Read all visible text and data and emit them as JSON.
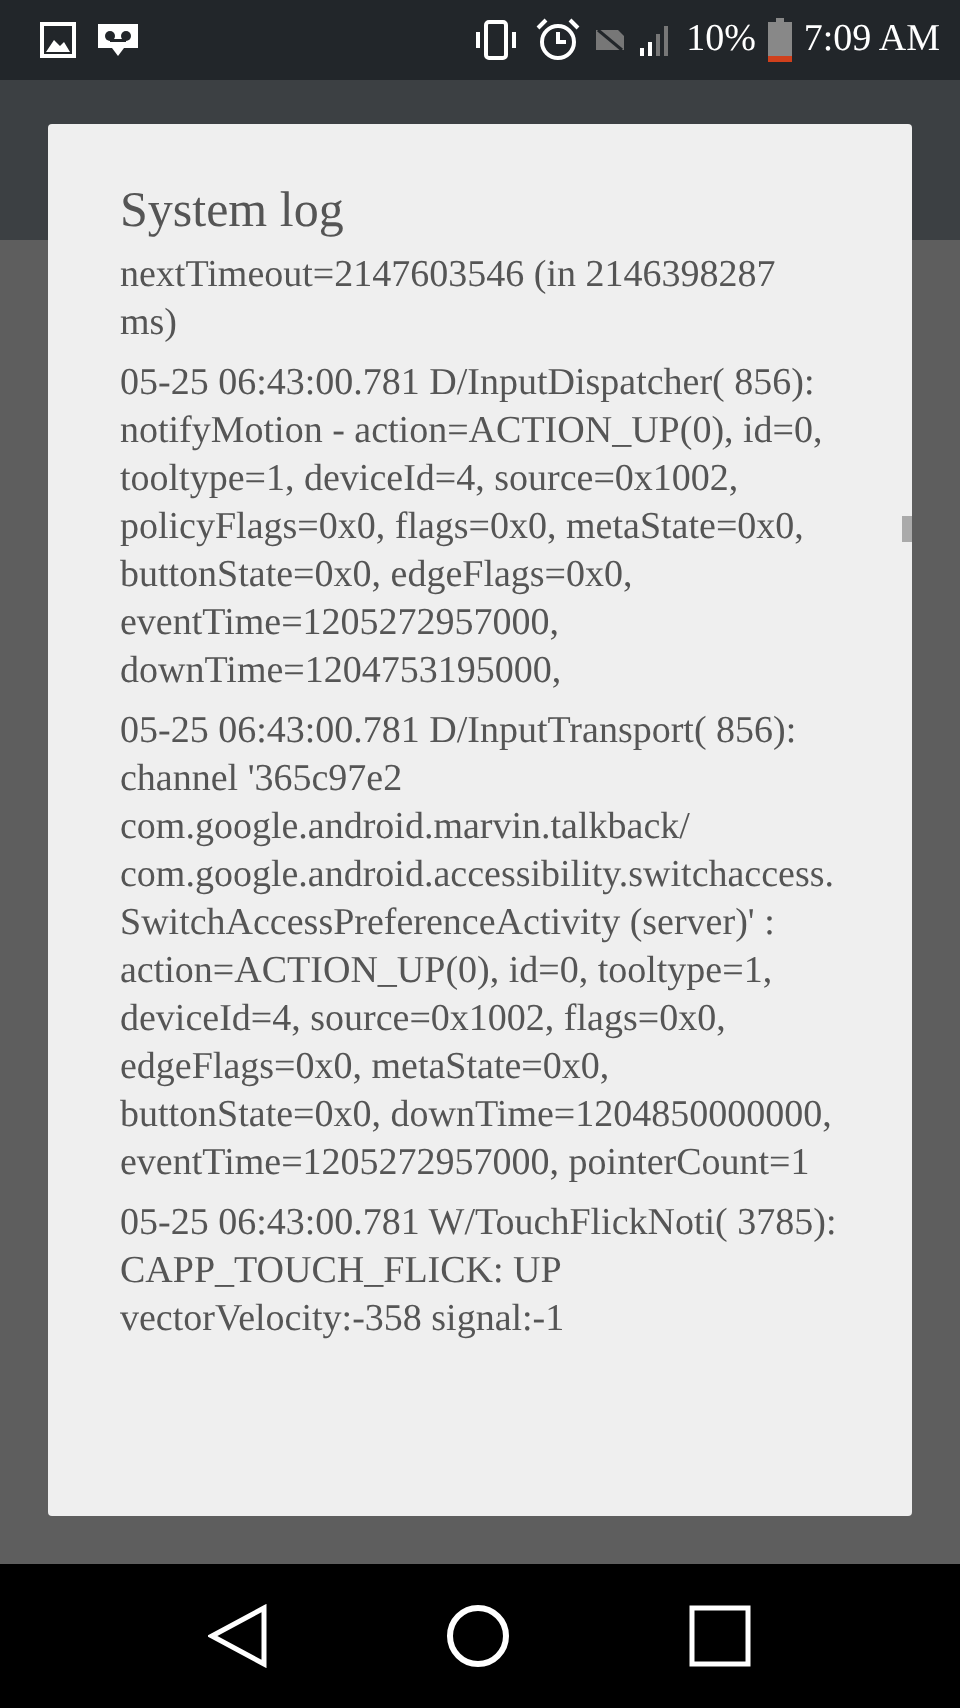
{
  "status_bar": {
    "battery_text": "10%",
    "time": "7:09 AM"
  },
  "dialog": {
    "title": "System log",
    "entries": [
      "nextTimeout=2147603546 (in 2146398287 ms)",
      "05-25 06:43:00.781 D/InputDispatcher( 856): notifyMotion - action=ACTION_UP(0), id=0, tooltype=1, deviceId=4, source=0x1002, policyFlags=0x0, flags=0x0, metaState=0x0, buttonState=0x0, edgeFlags=0x0, eventTime=1205272957000, downTime=1204753195000,",
      "05-25 06:43:00.781 D/InputTransport( 856): channel '365c97e2 com.google.android.marvin.talkback/ com.google.android.accessibility.switchaccess.SwitchAccessPreferenceActivity (server)' : action=ACTION_UP(0), id=0, tooltype=1, deviceId=4, source=0x1002, flags=0x0, edgeFlags=0x0, metaState=0x0, buttonState=0x0, downTime=1204850000000, eventTime=1205272957000, pointerCount=1",
      "05-25 06:43:00.781 W/TouchFlickNoti( 3785): CAPP_TOUCH_FLICK: UP vectorVelocity:-358 signal:-1"
    ]
  }
}
